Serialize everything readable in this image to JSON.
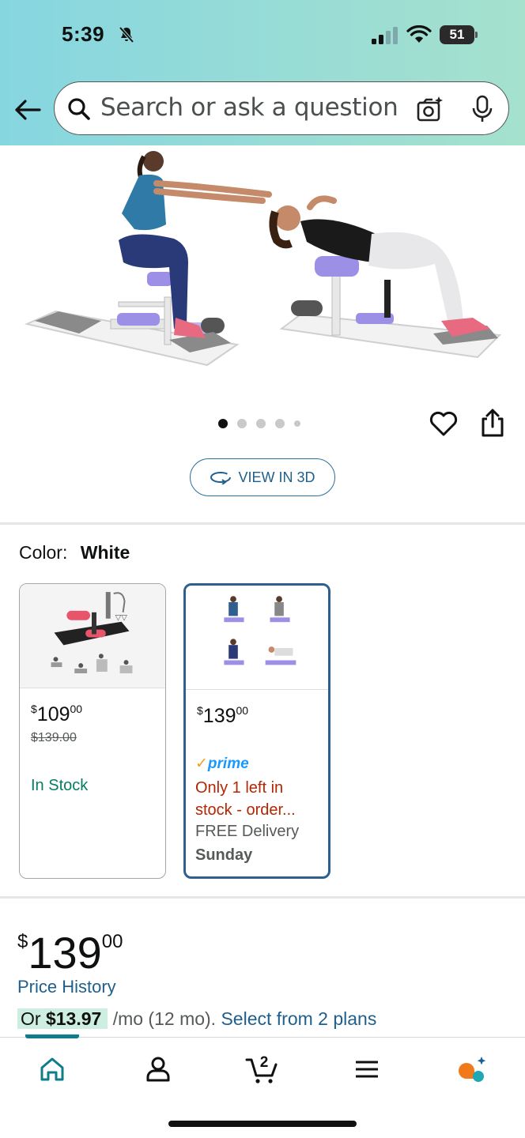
{
  "status_bar": {
    "time": "5:39",
    "battery": "51"
  },
  "search": {
    "placeholder": "Search or ask a question"
  },
  "gallery": {
    "view_3d_label": "VIEW IN 3D",
    "image_count": 5,
    "active_index": 0
  },
  "color": {
    "label": "Color:",
    "value": "White"
  },
  "variants": [
    {
      "price_main": "109",
      "price_cents": "00",
      "list_price": "$139.00",
      "stock": "In Stock"
    },
    {
      "price_main": "139",
      "price_cents": "00",
      "prime": "prime",
      "availability": "Only 1 left in stock - order...",
      "delivery": "FREE Delivery",
      "delivery_day": "Sunday"
    }
  ],
  "price": {
    "currency": "$",
    "main": "139",
    "cents": "00",
    "history_link": "Price History",
    "monthly_prefix": "Or",
    "monthly_amount": "$13.97",
    "monthly_terms": "/mo (12 mo).",
    "plans_link": "Select from 2 plans"
  },
  "bottom_nav": {
    "cart_count": "2",
    "items": [
      "home-icon",
      "account-icon",
      "cart-icon",
      "menu-icon",
      "rufus-icon"
    ]
  },
  "colors": {
    "header_start": "#86d6e0",
    "header_end": "#a5e1cd",
    "link": "#1f5f8b",
    "in_stock": "#067d62",
    "low_stock": "#b12704",
    "prime": "#1a98ff",
    "selected_border": "#2f5f8f"
  }
}
